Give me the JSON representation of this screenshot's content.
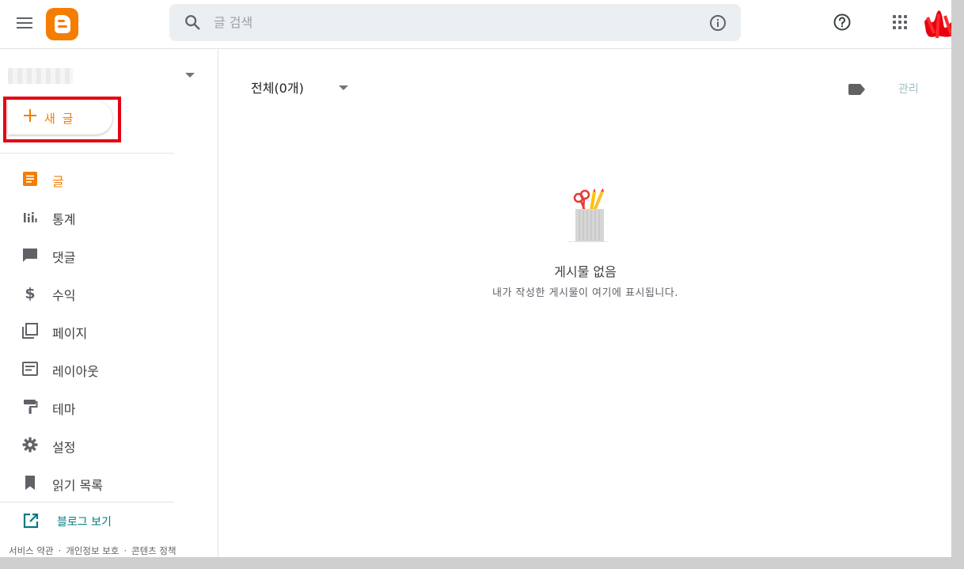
{
  "header": {
    "search_placeholder": "글 검색",
    "brand_color": "#f57d00"
  },
  "sidebar": {
    "new_post_label": "새 글",
    "items": [
      {
        "label": "글",
        "icon": "posts-icon",
        "active": true
      },
      {
        "label": "통계",
        "icon": "stats-icon",
        "active": false
      },
      {
        "label": "댓글",
        "icon": "comments-icon",
        "active": false
      },
      {
        "label": "수익",
        "icon": "dollar-icon",
        "active": false
      },
      {
        "label": "페이지",
        "icon": "pages-icon",
        "active": false
      },
      {
        "label": "레이아웃",
        "icon": "layout-icon",
        "active": false
      },
      {
        "label": "테마",
        "icon": "theme-icon",
        "active": false
      },
      {
        "label": "설정",
        "icon": "gear-icon",
        "active": false
      },
      {
        "label": "읽기 목록",
        "icon": "bookmark-icon",
        "active": false
      }
    ],
    "view_blog_label": "블로그 보기",
    "footer": {
      "terms": "서비스 약관",
      "privacy": "개인정보 보호",
      "content_policy": "콘텐츠 정책",
      "separator": "·"
    }
  },
  "main": {
    "filter_label": "전체(0개)",
    "manage_label": "관리",
    "empty_title": "게시물 없음",
    "empty_subtitle": "내가 작성한 게시물이 여기에 표시됩니다."
  },
  "colors": {
    "accent": "#f57d00",
    "link_teal": "#007b83",
    "highlight_box": "#e60012"
  }
}
